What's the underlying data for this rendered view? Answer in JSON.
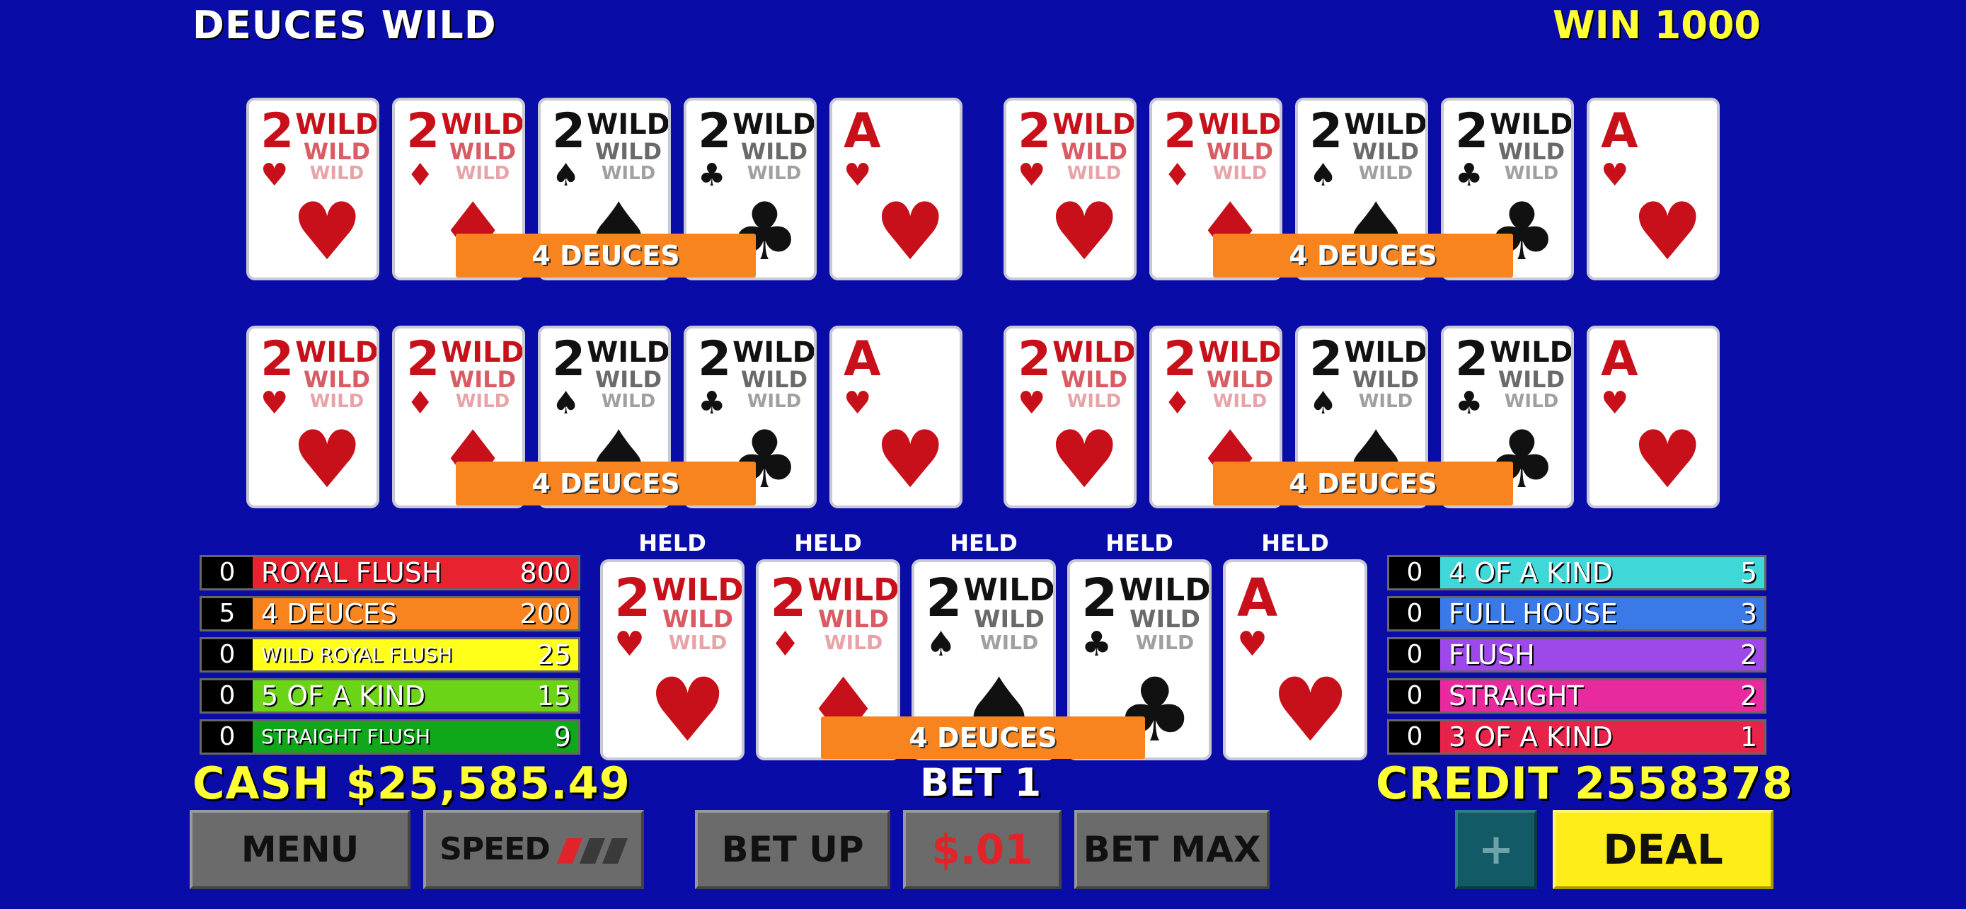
{
  "header": {
    "title": "DEUCES WILD",
    "win": "WIN 1000"
  },
  "card_text": {
    "wild": "WILD"
  },
  "hands": [
    {
      "banner": "4 DEUCES"
    },
    {
      "banner": "4 DEUCES"
    },
    {
      "banner": "4 DEUCES"
    },
    {
      "banner": "4 DEUCES"
    },
    {
      "banner": "4 DEUCES"
    }
  ],
  "cards": [
    {
      "rank": "2",
      "suit": "♥",
      "color": "red",
      "wild": true
    },
    {
      "rank": "2",
      "suit": "♦",
      "color": "red",
      "wild": true
    },
    {
      "rank": "2",
      "suit": "♠",
      "color": "black",
      "wild": true
    },
    {
      "rank": "2",
      "suit": "♣",
      "color": "black",
      "wild": true
    },
    {
      "rank": "A",
      "suit": "♥",
      "color": "red",
      "wild": false
    }
  ],
  "held": [
    "HELD",
    "HELD",
    "HELD",
    "HELD",
    "HELD"
  ],
  "paytable_left": [
    {
      "count": "0",
      "name": "ROYAL FLUSH",
      "pay": "800",
      "color": "#e8232f"
    },
    {
      "count": "5",
      "name": "4 DEUCES",
      "pay": "200",
      "color": "#f7841f"
    },
    {
      "count": "0",
      "name": "WILD ROYAL FLUSH",
      "pay": "25",
      "color": "#ffff1a"
    },
    {
      "count": "0",
      "name": "5 OF A KIND",
      "pay": "15",
      "color": "#6cd416"
    },
    {
      "count": "0",
      "name": "STRAIGHT FLUSH",
      "pay": "9",
      "color": "#10a81a"
    }
  ],
  "paytable_right": [
    {
      "count": "0",
      "name": "4 OF A KIND",
      "pay": "5",
      "color": "#3fd7d7"
    },
    {
      "count": "0",
      "name": "FULL HOUSE",
      "pay": "3",
      "color": "#3a7ae8"
    },
    {
      "count": "0",
      "name": "FLUSH",
      "pay": "2",
      "color": "#9d48e8"
    },
    {
      "count": "0",
      "name": "STRAIGHT",
      "pay": "2",
      "color": "#e82a9e"
    },
    {
      "count": "0",
      "name": "3 OF A KIND",
      "pay": "1",
      "color": "#e8234a"
    }
  ],
  "status": {
    "cash": "CASH $25,585.49",
    "bet": "BET 1",
    "credit": "CREDIT 2558378"
  },
  "buttons": {
    "menu": "MENU",
    "speed": "SPEED",
    "bet_up": "BET UP",
    "denom": "$.01",
    "bet_max": "BET MAX",
    "plus": "+",
    "deal": "DEAL"
  },
  "colors": {
    "background": "#0a0ca8",
    "accent_yellow": "#ffff33",
    "banner_orange": "#f7841f"
  }
}
